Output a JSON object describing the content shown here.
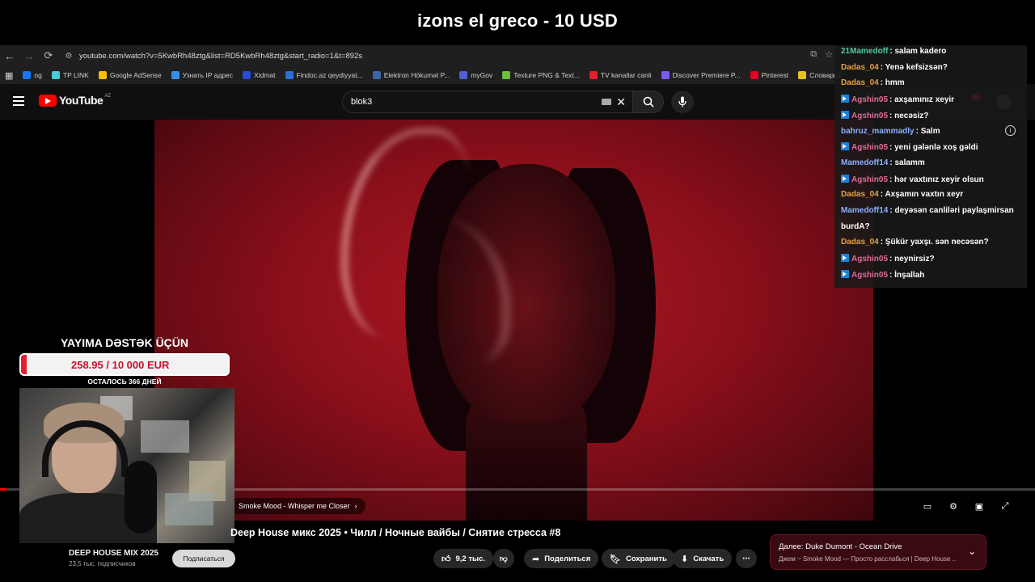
{
  "stream": {
    "title": "izons el greco - 10 USD"
  },
  "browser": {
    "url": "youtube.com/watch?v=5KwbRh48ztg&list=RD5KwbRh48ztg&start_radio=1&t=892s",
    "bookmarks": [
      {
        "label": "og",
        "color": "#1877f2"
      },
      {
        "label": "TP LINK",
        "color": "#4acbd6"
      },
      {
        "label": "Google AdSense",
        "color": "#fbbc04"
      },
      {
        "label": "Узнать IP адрес",
        "color": "#3a8ee6"
      },
      {
        "label": "Xidmat",
        "color": "#2a4bd6"
      },
      {
        "label": "Findoc.az qeydiyyat...",
        "color": "#2c6fd6"
      },
      {
        "label": "Elektron Hökumət P...",
        "color": "#3a66a8"
      },
      {
        "label": "myGov",
        "color": "#4f5fd6"
      },
      {
        "label": "Texture PNG & Text...",
        "color": "#6bbf3a"
      },
      {
        "label": "TV kanallar canli",
        "color": "#e0202a"
      },
      {
        "label": "Discover Premiere P...",
        "color": "#7a5cf0"
      },
      {
        "label": "Pinterest",
        "color": "#e60023"
      },
      {
        "label": "Словарь игровых т...",
        "color": "#e8c020"
      }
    ]
  },
  "youtube": {
    "logo_text": "YouTube",
    "logo_region": "AZ",
    "search_value": "blok3",
    "notification_count": "9+"
  },
  "player": {
    "progress": 0.006,
    "next_chip": "Smoke Mood - Whisper me Closer"
  },
  "video": {
    "title": "Deep House микс 2025 • Чилл / Ночные вайбы / Снятие стресса #8",
    "channel": "DEEP HOUSE MIX 2025",
    "subs": "23,5 тыс. подписчиков",
    "subscribe_label": "Подписаться",
    "like_count": "9,2 тыс.",
    "share_label": "Поделиться",
    "save_label": "Сохранить",
    "download_label": "Скачать"
  },
  "up_next": {
    "line1": "Далее: Duke Dumont - Ocean Drive",
    "line2": "Джем ~ Smoke Mood — Просто расслабься | Deep House ..."
  },
  "chat": [
    {
      "user": "21Mamedoff",
      "text": ": salam kadero",
      "color": "c-green",
      "badge": false
    },
    {
      "user": "Dadas_04",
      "text": ": Yenə kefsizsən?",
      "color": "c-orange",
      "badge": false
    },
    {
      "user": "Dadas_04",
      "text": ": hmm",
      "color": "c-orange",
      "badge": false
    },
    {
      "user": "Agshin05",
      "text": ": axşamınız xeyir",
      "color": "c-pink",
      "badge": true
    },
    {
      "user": "Agshin05",
      "text": ": necəsiz?",
      "color": "c-pink",
      "badge": true
    },
    {
      "user": "bahruz_mammadly",
      "text": ": Salm",
      "color": "c-blue",
      "badge": false
    },
    {
      "user": "Agshin05",
      "text": ": yeni gələnlə xoş gəldi",
      "color": "c-pink",
      "badge": true
    },
    {
      "user": "Mamedoff14",
      "text": ": salamm",
      "color": "c-blue",
      "badge": false
    },
    {
      "user": "Agshin05",
      "text": ": hər vaxtınız xeyir olsun",
      "color": "c-pink",
      "badge": true
    },
    {
      "user": "Dadas_04",
      "text": ": Axşamın vaxtın xeyr",
      "color": "c-orange",
      "badge": false
    },
    {
      "user": "Mamedoff14",
      "text": ": deyəsən canliləri paylaşmirsan",
      "color": "c-blue",
      "badge": false
    },
    {
      "user": "",
      "text": "burdA?",
      "color": "c-blue",
      "badge": false
    },
    {
      "user": "Dadas_04",
      "text": ": Şükür yaxşı. sən necəsən?",
      "color": "c-orange",
      "badge": false
    },
    {
      "user": "Agshin05",
      "text": ": neynirsiz?",
      "color": "c-pink",
      "badge": true
    },
    {
      "user": "Agshin05",
      "text": ": İnşallah",
      "color": "c-pink",
      "badge": true
    }
  ],
  "donation": {
    "title": "YAYIMA DƏSTƏK ÜÇÜN",
    "amount_text": "258.95 / 10 000 EUR",
    "progress": 0.026,
    "days_left": "ОСТАЛОСЬ 366 ДНЕЙ"
  }
}
